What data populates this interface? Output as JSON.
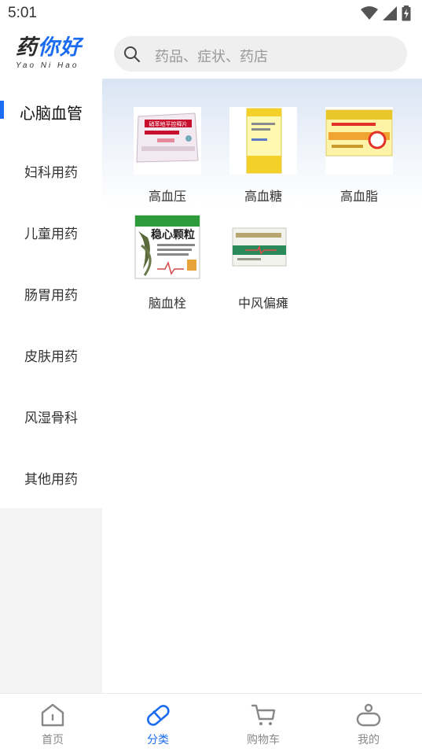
{
  "status_bar": {
    "time": "5:01"
  },
  "header": {
    "logo_main": [
      "药",
      "你好"
    ],
    "logo_sub": "Yao Ni Hao",
    "search_placeholder": "药品、症状、药店"
  },
  "sidebar": {
    "items": [
      {
        "label": "心脑血管",
        "active": true
      },
      {
        "label": "妇科用药",
        "active": false
      },
      {
        "label": "儿童用药",
        "active": false
      },
      {
        "label": "肠胃用药",
        "active": false
      },
      {
        "label": "皮肤用药",
        "active": false
      },
      {
        "label": "风湿骨科",
        "active": false
      },
      {
        "label": "其他用药",
        "active": false
      }
    ]
  },
  "content": {
    "drugs": [
      {
        "name": "高血压",
        "box_text": "硝苯地平控释片",
        "box_colors": [
          "#f2eaf0",
          "#c8102e"
        ]
      },
      {
        "name": "高血糖",
        "box_text": "",
        "box_colors": [
          "#fff8b0",
          "#f3d12a"
        ]
      },
      {
        "name": "高血脂",
        "box_text": "",
        "box_colors": [
          "#fff3a8",
          "#e3312a"
        ]
      },
      {
        "name": "脑血栓",
        "box_text": "稳心颗粒",
        "box_colors": [
          "#ffffff",
          "#2e9b3a"
        ]
      },
      {
        "name": "中风偏瘫",
        "box_text": "",
        "box_colors": [
          "#f3f3ee",
          "#2a8a5a"
        ]
      }
    ]
  },
  "bottom_nav": {
    "items": [
      {
        "label": "首页",
        "icon": "home-icon",
        "active": false
      },
      {
        "label": "分类",
        "icon": "pill-icon",
        "active": true
      },
      {
        "label": "购物车",
        "icon": "cart-icon",
        "active": false
      },
      {
        "label": "我的",
        "icon": "profile-icon",
        "active": false
      }
    ]
  },
  "colors": {
    "accent": "#1b6cf0",
    "inactive": "#888888",
    "sidebar_bg": "#f3f3f3"
  }
}
